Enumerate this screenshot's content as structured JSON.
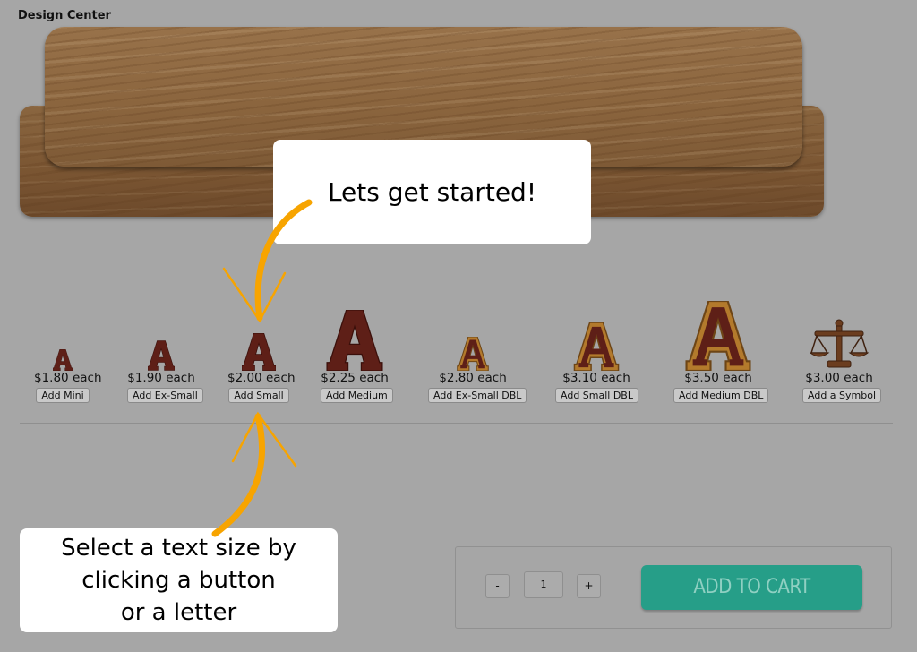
{
  "page": {
    "title": "Design Center"
  },
  "callouts": {
    "top": "Lets get started!",
    "bottom": "Select a text size by\nclicking a button\nor a letter"
  },
  "letters": [
    {
      "glyph": "A",
      "price": "$1.80 each",
      "button": "Add Mini",
      "style": "solid"
    },
    {
      "glyph": "A",
      "price": "$1.90 each",
      "button": "Add Ex-Small",
      "style": "solid"
    },
    {
      "glyph": "A",
      "price": "$2.00 each",
      "button": "Add Small",
      "style": "solid"
    },
    {
      "glyph": "A",
      "price": "$2.25 each",
      "button": "Add Medium",
      "style": "solid"
    },
    {
      "glyph": "A",
      "price": "$2.80 each",
      "button": "Add Ex-Small DBL",
      "style": "double"
    },
    {
      "glyph": "A",
      "price": "$3.10 each",
      "button": "Add Small DBL",
      "style": "double"
    },
    {
      "glyph": "A",
      "price": "$3.50 each",
      "button": "Add Medium DBL",
      "style": "double"
    },
    {
      "glyph": "scales",
      "price": "$3.00 each",
      "button": "Add a Symbol",
      "style": "symbol"
    }
  ],
  "cart": {
    "minus": "-",
    "plus": "+",
    "quantity": "1",
    "add_to_cart": "ADD TO CART"
  },
  "colors": {
    "background": "#a6a6a6",
    "cart_button": "#269e88",
    "cart_button_text": "#8fd0c2",
    "arrow": "#f7a400",
    "letter_wood_dark": "#5e1f17",
    "letter_wood_light": "#b37a2c"
  }
}
